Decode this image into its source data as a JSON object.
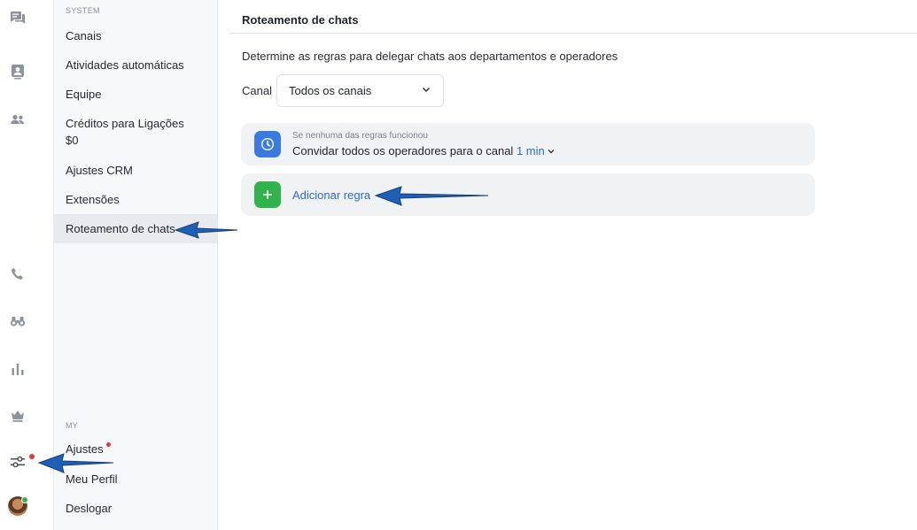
{
  "rail": {
    "icons": [
      "chats-icon",
      "contacts-icon",
      "team-icon",
      "phone-icon",
      "binoculars-icon",
      "stats-icon",
      "crown-icon",
      "settings-sliders-icon",
      "avatar"
    ]
  },
  "sidebar": {
    "system_section": "SYSTEM",
    "system_items": [
      {
        "label": "Canais"
      },
      {
        "label": "Atividades automáticas"
      },
      {
        "label": "Equipe"
      },
      {
        "label": "Créditos para Ligações",
        "sub": "$0"
      },
      {
        "label": "Ajustes CRM"
      },
      {
        "label": "Extensões"
      },
      {
        "label": "Roteamento de chats",
        "active": true
      }
    ],
    "my_section": "MY",
    "my_items": [
      {
        "label": "Ajustes",
        "notification": true
      },
      {
        "label": "Meu Perfil"
      },
      {
        "label": "Deslogar"
      }
    ]
  },
  "main": {
    "title": "Roteamento de chats",
    "description": "Determine as regras para delegar chats aos departamentos e operadores",
    "canal_label": "Canal",
    "canal_value": "Todos os canais",
    "fallback_rule": {
      "caption": "Se nenhuma das regras funcionou",
      "text": "Convidar todos os operadores para o canal",
      "time": "1 min"
    },
    "add_rule_label": "Adicionar regra"
  },
  "colors": {
    "accent": "#2e6bd1",
    "clock_icon_bg": "#3b7be0",
    "add_icon_bg": "#2fb34a",
    "arrow": "#1f5fb5",
    "notification": "#e53935",
    "online": "#35b449"
  }
}
